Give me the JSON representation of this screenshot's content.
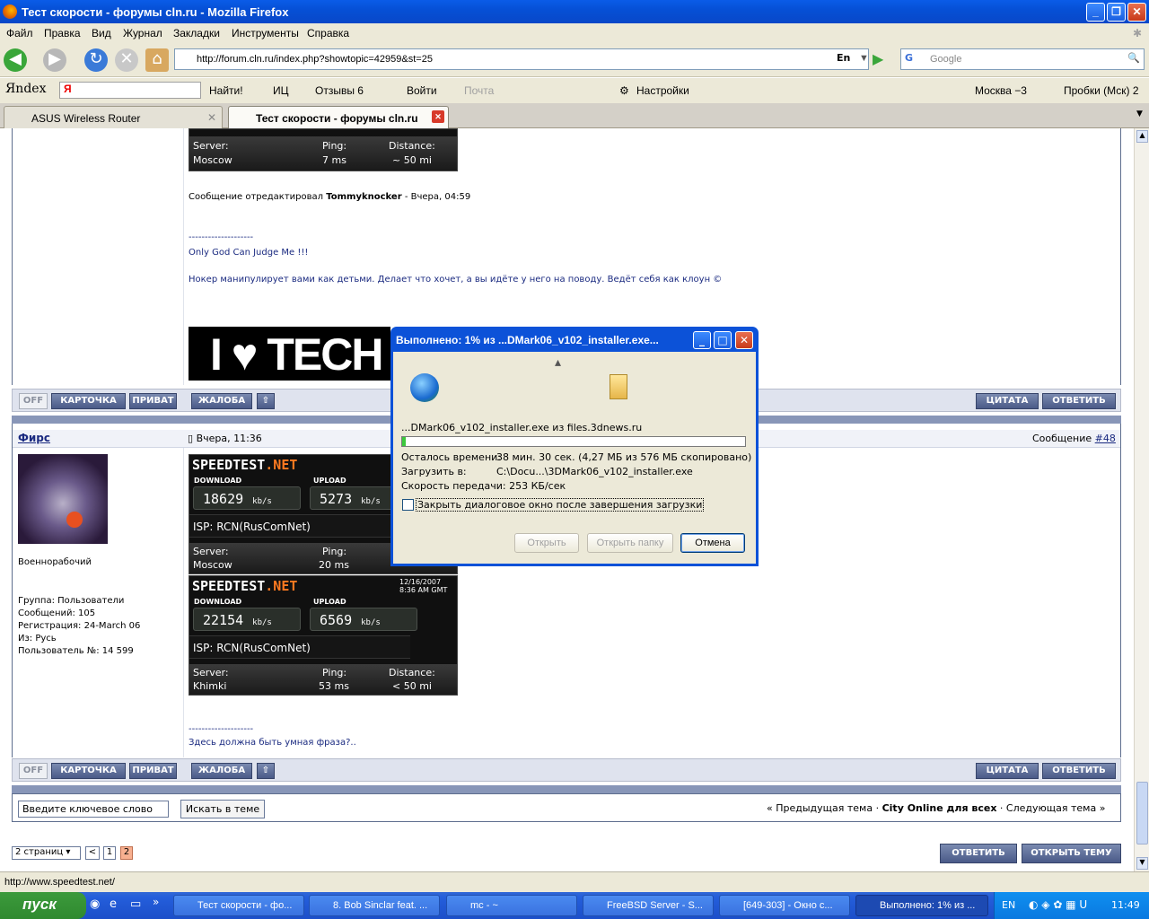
{
  "window": {
    "title": "Тест скорости - форумы cln.ru - Mozilla Firefox"
  },
  "menu": [
    "Файл",
    "Правка",
    "Вид",
    "Журнал",
    "Закладки",
    "Инструменты",
    "Справка"
  ],
  "nav": {
    "url": "http://forum.cln.ru/index.php?showtopic=42959&st=25",
    "lang": "En",
    "search_placeholder": "Google"
  },
  "yandex": {
    "logo": "Яndex",
    "find": "Найти!",
    "ic": "ИЦ",
    "reviews": "Отзывы 6",
    "login": "Войти",
    "mail": "Почта",
    "settings": "Настройки",
    "weather": "Москва −3",
    "traffic": "Пробки (Мск) 2"
  },
  "tabs": [
    {
      "label": "ASUS Wireless Router"
    },
    {
      "label": "Тест скорости - форумы cln.ru"
    }
  ],
  "post1": {
    "st": {
      "server_lbl": "Server:",
      "server": "Moscow",
      "ping_lbl": "Ping:",
      "ping": "7 ms",
      "dist_lbl": "Distance:",
      "dist": "~ 50 mi"
    },
    "edited_prefix": "Сообщение отредактировал",
    "edited_by": "Tommyknocker",
    "edited_time": "- Вчера, 04:59",
    "sig_sep": "--------------------",
    "sig1": "Only God Can Judge Me !!!",
    "sig2": "Нокер манипулирует вами как детьми. Делает что хочет, а вы идёте у него на поводу. Ведёт себя как клоун ©",
    "banner": "I ♥ TECH"
  },
  "buttons": {
    "off": "OFF",
    "card": "КАРТОЧКА",
    "priv": "ПРИВАТ",
    "complaint": "ЖАЛОБА",
    "quote": "ЦИТАТА",
    "reply": "ОТВЕТИТЬ"
  },
  "post2": {
    "author": "Фирс",
    "date": "Вчера, 11:36",
    "msg_prefix": "Сообщение",
    "msg_num": "#48",
    "rank": "Военнорабочий",
    "group": "Группа: Пользователи",
    "posts": "Сообщений: 105",
    "reg": "Регистрация: 24-March 06",
    "from": "Из: Русь",
    "uid": "Пользователь №: 14 599",
    "st1": {
      "logo_a": "SPEEDTEST",
      "logo_b": ".NET",
      "dl_lbl": "DOWNLOAD",
      "ul_lbl": "UPLOAD",
      "dl": "18629",
      "ul": "5273",
      "unit": "kb/s",
      "isp": "ISP: RCN(RusComNet)",
      "server_lbl": "Server:",
      "server": "Moscow",
      "ping_lbl": "Ping:",
      "ping": "20 ms"
    },
    "st2": {
      "logo_a": "SPEEDTEST",
      "logo_b": ".NET",
      "date": "12/16/2007",
      "time": "8:36 AM GMT",
      "dl_lbl": "DOWNLOAD",
      "ul_lbl": "UPLOAD",
      "dl": "22154",
      "ul": "6569",
      "unit": "kb/s",
      "isp": "ISP: RCN(RusComNet)",
      "server_lbl": "Server:",
      "server": "Khimki",
      "ping_lbl": "Ping:",
      "ping": "53 ms",
      "dist_lbl": "Distance:",
      "dist": "< 50 mi"
    },
    "sig_sep": "--------------------",
    "sig": "Здесь должна быть умная фраза?.."
  },
  "footer": {
    "search_value": "Введите ключевое слово",
    "search_btn": "Искать в теме",
    "prev": "« Предыдущая тема",
    "sep": "·",
    "forum": "City Online для всех",
    "next": "Следующая тема »",
    "pages": "2 страниц",
    "prev_page": "<",
    "p1": "1",
    "p2": "2",
    "reply": "ОТВЕТИТЬ",
    "new_topic": "ОТКРЫТЬ ТЕМУ"
  },
  "dialog": {
    "title": "Выполнено: 1% из ...DMark06_v102_installer.exe...",
    "file": "...DMark06_v102_installer.exe из files.3dnews.ru",
    "progress": 0.01,
    "remain_lbl": "Осталось времени:",
    "remain": "38 мин. 30 сек. (4,27 МБ из 576 МБ скопировано)",
    "dest_lbl": "Загрузить в:",
    "dest": "C:\\Docu...\\3DMark06_v102_installer.exe",
    "speed_lbl": "Скорость передачи:",
    "speed": "253 КБ/сек",
    "close_chk": "Закрыть диалоговое окно после завершения загрузки",
    "open": "Открыть",
    "open_folder": "Открыть папку",
    "cancel": "Отмена"
  },
  "status": "http://www.speedtest.net/",
  "taskbar": {
    "start": "пуск",
    "items": [
      "Тест скорости - фо...",
      "8. Bob Sinclar feat. ...",
      "mc - ~",
      "FreeBSD Server - S...",
      "[649-303] - Окно с...",
      "Выполнено: 1% из ..."
    ],
    "lang": "EN",
    "clock": "11:49"
  }
}
